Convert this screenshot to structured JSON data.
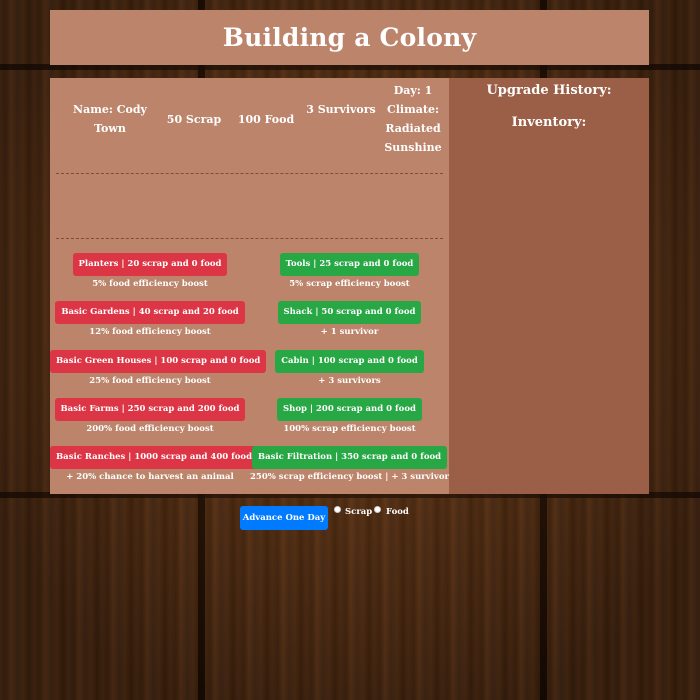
{
  "title": "Building a Colony",
  "stats": {
    "name": "Name: Cody Town",
    "scrap": "50 Scrap",
    "food": "100 Food",
    "survivors": "3 Survivors",
    "day_climate": "Day: 1 Climate: Radiated Sunshine"
  },
  "sidebar": {
    "upgrade_history": "Upgrade History:",
    "inventory": "Inventory:"
  },
  "food_upgrades": [
    {
      "label": "Planters | 20 scrap and 0 food",
      "desc": "5% food efficiency boost"
    },
    {
      "label": "Basic Gardens | 40 scrap and 20 food",
      "desc": "12% food efficiency boost"
    },
    {
      "label": "Basic Green Houses | 100 scrap and 0 food",
      "desc": "25% food efficiency boost"
    },
    {
      "label": "Basic Farms | 250 scrap and 200 food",
      "desc": "200% food efficiency boost"
    },
    {
      "label": "Basic Ranches | 1000 scrap and 400 food",
      "desc": "+ 20% chance to harvest an animal"
    }
  ],
  "scrap_upgrades": [
    {
      "label": "Tools | 25 scrap and 0 food",
      "desc": "5% scrap efficiency boost"
    },
    {
      "label": "Shack | 50 scrap and 0 food",
      "desc": "+ 1 survivor"
    },
    {
      "label": "Cabin | 100 scrap and 0 food",
      "desc": "+ 3 survivors"
    },
    {
      "label": "Shop | 200 scrap and 0 food",
      "desc": "100% scrap efficiency boost"
    },
    {
      "label": "Basic Filtration | 350 scrap and 0 food",
      "desc": "250% scrap efficiency boost | + 3 survivor"
    }
  ],
  "controls": {
    "advance_label": "Advance One Day",
    "radio_scrap": "Scrap",
    "radio_food": "Food"
  },
  "colors": {
    "panel": "#bb846b",
    "sidebar": "#9a5f46",
    "red_button": "#dc3545",
    "green_button": "#28a745",
    "blue_button": "#007bff"
  }
}
